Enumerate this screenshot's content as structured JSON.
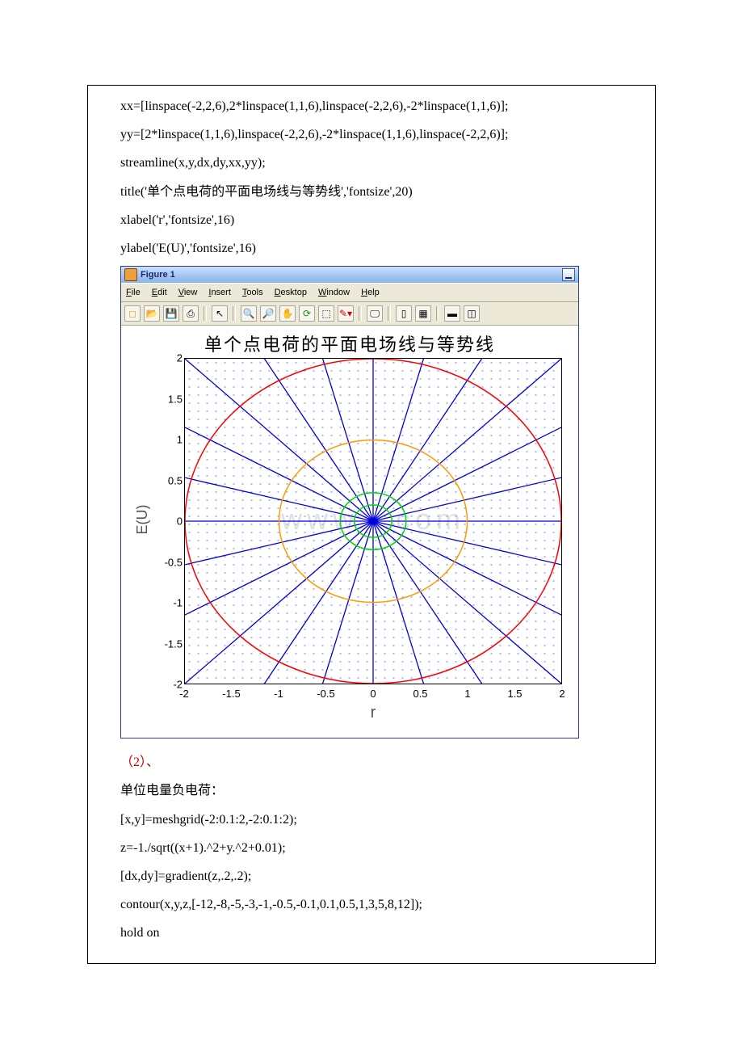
{
  "code_before": [
    "xx=[linspace(-2,2,6),2*linspace(1,1,6),linspace(-2,2,6),-2*linspace(1,1,6)];",
    "yy=[2*linspace(1,1,6),linspace(-2,2,6),-2*linspace(1,1,6),linspace(-2,2,6)];",
    "streamline(x,y,dx,dy,xx,yy);",
    "title('单个点电荷的平面电场线与等势线','fontsize',20)",
    "xlabel('r','fontsize',16)",
    "ylabel('E(U)','fontsize',16)"
  ],
  "fig_window": {
    "title": "Figure 1",
    "menu": [
      "File",
      "Edit",
      "View",
      "Insert",
      "Tools",
      "Desktop",
      "Window",
      "Help"
    ]
  },
  "chart_data": {
    "type": "line",
    "title": "单个点电荷的平面电场线与等势线",
    "xlabel": "r",
    "ylabel": "E(U)",
    "xlim": [
      -2,
      2
    ],
    "ylim": [
      -2,
      2
    ],
    "xticks": [
      -2,
      -1.5,
      -1,
      -0.5,
      0,
      0.5,
      1,
      1.5,
      2
    ],
    "yticks": [
      -2,
      -1.5,
      -1,
      -0.5,
      0,
      0.5,
      1,
      1.5,
      2
    ],
    "equipotential_radii": [
      0.2,
      0.35,
      1.0,
      2.0
    ],
    "equipotential_colors": [
      "#00d800",
      "#00d800",
      "#ff9a00",
      "#ff0000"
    ],
    "field_line_count": 24,
    "watermark": "www.      .com"
  },
  "after": {
    "heading": "（2）、",
    "subtitle": "单位电量负电荷：",
    "code": [
      "[x,y]=meshgrid(-2:0.1:2,-2:0.1:2);",
      "z=-1./sqrt((x+1).^2+y.^2+0.01);",
      "[dx,dy]=gradient(z,.2,.2);",
      "contour(x,y,z,[-12,-8,-5,-3,-1,-0.5,-0.1,0.1,0.5,1,3,5,8,12]);",
      "hold on"
    ]
  }
}
